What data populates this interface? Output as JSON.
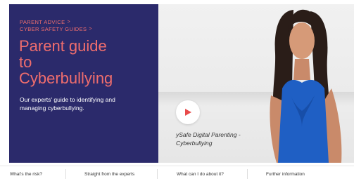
{
  "breadcrumbs": [
    {
      "label": "PARENT ADVICE"
    },
    {
      "label": "CYBER SAFETY GUIDES"
    }
  ],
  "breadcrumb_separator": ">",
  "hero": {
    "title_line1": "Parent guide",
    "title_line2": "to",
    "title_line3": "Cyberbullying",
    "subtitle": "Our experts' guide to identifying and managing cyberbullying."
  },
  "video": {
    "caption_line1": "ySafe Digital Parenting -",
    "caption_line2": "Cyberbullying",
    "play_icon": "play-icon"
  },
  "tabs": [
    {
      "label": "What's the risk?"
    },
    {
      "label": "Straight from the experts"
    },
    {
      "label": "What can I do about it?"
    },
    {
      "label": "Further information"
    }
  ],
  "colors": {
    "panel": "#2b2a6b",
    "accent": "#ef6d6d",
    "play": "#e84a4a"
  }
}
